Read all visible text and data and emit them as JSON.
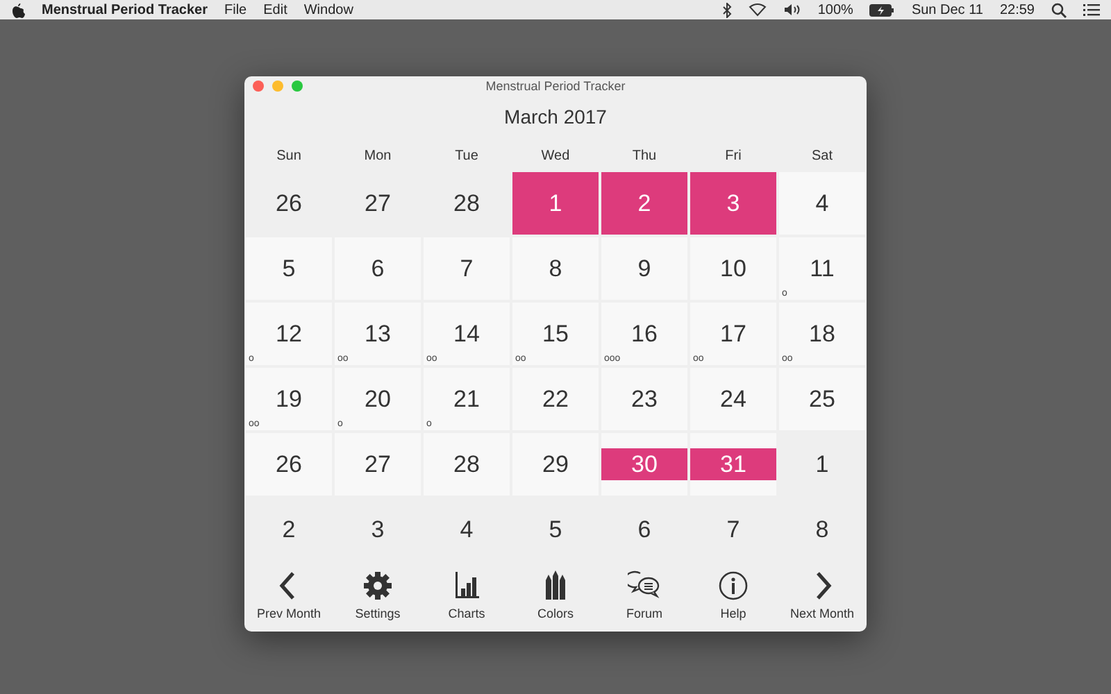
{
  "menubar": {
    "app": "Menstrual Period Tracker",
    "menus": [
      "File",
      "Edit",
      "Window"
    ],
    "battery": "100%",
    "date": "Sun Dec 11",
    "time": "22:59"
  },
  "window": {
    "title": "Menstrual Period Tracker",
    "month": "March 2017",
    "weekdays": [
      "Sun",
      "Mon",
      "Tue",
      "Wed",
      "Thu",
      "Fri",
      "Sat"
    ],
    "days": [
      {
        "day": "26",
        "kind": "outside"
      },
      {
        "day": "27",
        "kind": "outside"
      },
      {
        "day": "28",
        "kind": "outside"
      },
      {
        "day": "1",
        "kind": "period"
      },
      {
        "day": "2",
        "kind": "period"
      },
      {
        "day": "3",
        "kind": "period"
      },
      {
        "day": "4",
        "kind": "current"
      },
      {
        "day": "5",
        "kind": "current"
      },
      {
        "day": "6",
        "kind": "current"
      },
      {
        "day": "7",
        "kind": "current"
      },
      {
        "day": "8",
        "kind": "current"
      },
      {
        "day": "9",
        "kind": "current"
      },
      {
        "day": "10",
        "kind": "current"
      },
      {
        "day": "11",
        "kind": "current",
        "dots": "o"
      },
      {
        "day": "12",
        "kind": "current",
        "dots": "o"
      },
      {
        "day": "13",
        "kind": "current",
        "dots": "oo"
      },
      {
        "day": "14",
        "kind": "current",
        "dots": "oo"
      },
      {
        "day": "15",
        "kind": "current",
        "dots": "oo"
      },
      {
        "day": "16",
        "kind": "current",
        "dots": "ooo"
      },
      {
        "day": "17",
        "kind": "current",
        "dots": "oo"
      },
      {
        "day": "18",
        "kind": "current",
        "dots": "oo"
      },
      {
        "day": "19",
        "kind": "current",
        "dots": "oo"
      },
      {
        "day": "20",
        "kind": "current",
        "dots": "o"
      },
      {
        "day": "21",
        "kind": "current",
        "dots": "o"
      },
      {
        "day": "22",
        "kind": "current"
      },
      {
        "day": "23",
        "kind": "current"
      },
      {
        "day": "24",
        "kind": "current"
      },
      {
        "day": "25",
        "kind": "current"
      },
      {
        "day": "26",
        "kind": "current"
      },
      {
        "day": "27",
        "kind": "current"
      },
      {
        "day": "28",
        "kind": "current"
      },
      {
        "day": "29",
        "kind": "current"
      },
      {
        "day": "30",
        "kind": "period-band"
      },
      {
        "day": "31",
        "kind": "period-band"
      },
      {
        "day": "1",
        "kind": "outside"
      },
      {
        "day": "2",
        "kind": "outside"
      },
      {
        "day": "3",
        "kind": "outside"
      },
      {
        "day": "4",
        "kind": "outside"
      },
      {
        "day": "5",
        "kind": "outside"
      },
      {
        "day": "6",
        "kind": "outside"
      },
      {
        "day": "7",
        "kind": "outside"
      },
      {
        "day": "8",
        "kind": "outside"
      }
    ],
    "toolbar": [
      {
        "label": "Prev Month",
        "kind": "prev"
      },
      {
        "label": "Settings",
        "kind": "settings"
      },
      {
        "label": "Charts",
        "kind": "charts"
      },
      {
        "label": "Colors",
        "kind": "colors"
      },
      {
        "label": "Forum",
        "kind": "forum"
      },
      {
        "label": "Help",
        "kind": "help"
      },
      {
        "label": "Next Month",
        "kind": "next"
      }
    ]
  }
}
